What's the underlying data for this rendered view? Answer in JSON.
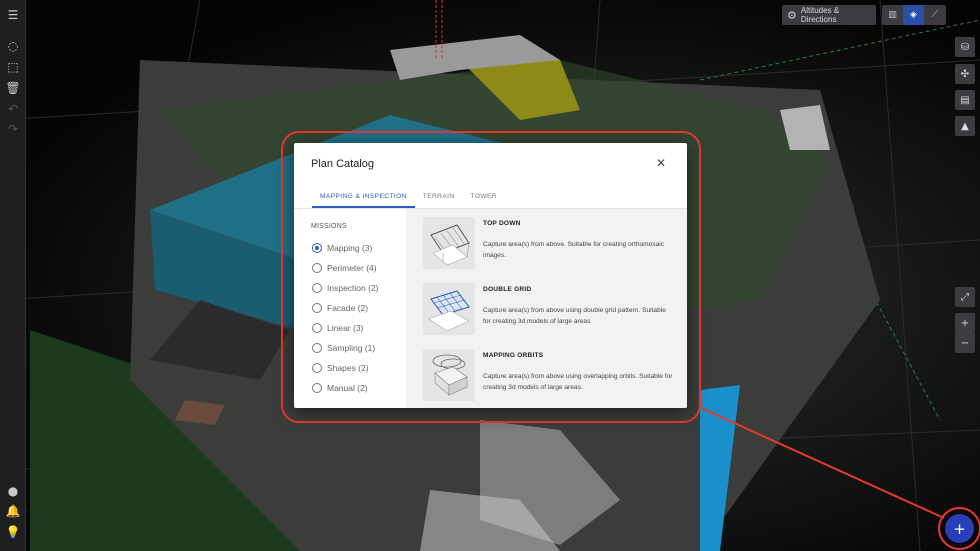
{
  "toolbar": {
    "altitudes_label": "Altitudes & Directions",
    "view_modes": [
      {
        "icon": "map-2d-icon",
        "active": false
      },
      {
        "icon": "cube-3d-icon",
        "active": true
      },
      {
        "icon": "terrain-profile-icon",
        "active": false
      }
    ]
  },
  "left_toolbar": {
    "icons": [
      "menu-icon",
      "lasso-icon",
      "select-area-icon",
      "delete-icon",
      "undo-icon",
      "redo-icon",
      "user-icon",
      "notification-bell-icon",
      "lightbulb-icon"
    ]
  },
  "right_toolbar": {
    "icons": [
      "save-plan-icon",
      "drone-icon",
      "layers-icon",
      "terrain-icon",
      "fit-view-icon",
      "zoom-in-icon",
      "zoom-out-icon"
    ],
    "zoom_in": "+",
    "zoom_out": "−"
  },
  "modal": {
    "title": "Plan Catalog",
    "close_glyph": "✕",
    "tabs": [
      {
        "label": "MAPPING & INSPECTION",
        "active": true
      },
      {
        "label": "TERRAIN",
        "active": false
      },
      {
        "label": "TOWER",
        "active": false
      }
    ],
    "missions_title": "MISSIONS",
    "missions": [
      {
        "label": "Mapping (3)",
        "selected": true
      },
      {
        "label": "Perimeter (4)",
        "selected": false
      },
      {
        "label": "Inspection (2)",
        "selected": false
      },
      {
        "label": "Facade (2)",
        "selected": false
      },
      {
        "label": "Linear (3)",
        "selected": false
      },
      {
        "label": "Sampling (1)",
        "selected": false
      },
      {
        "label": "Shapes (2)",
        "selected": false
      },
      {
        "label": "Manual (2)",
        "selected": false
      }
    ],
    "plans": [
      {
        "name": "TOP DOWN",
        "description": "Capture area(s) from above. Suitable for creating orthomosaic images.",
        "icon": "top-down-plan-icon"
      },
      {
        "name": "DOUBLE GRID",
        "description": "Capture area(s) from above using double grid pattern. Suitable for creating 3d models of large areas",
        "icon": "double-grid-plan-icon"
      },
      {
        "name": "MAPPING ORBITS",
        "description": "Capture area(s) from above using overlapping orbits. Suitable for creating 3d models of large areas.",
        "icon": "mapping-orbits-plan-icon"
      }
    ]
  },
  "fab": {
    "glyph": "+",
    "icon": "add-plan-icon"
  },
  "colors": {
    "accent": "#2a59c0",
    "highlight": "#e5392f",
    "fab": "#2740b8"
  }
}
